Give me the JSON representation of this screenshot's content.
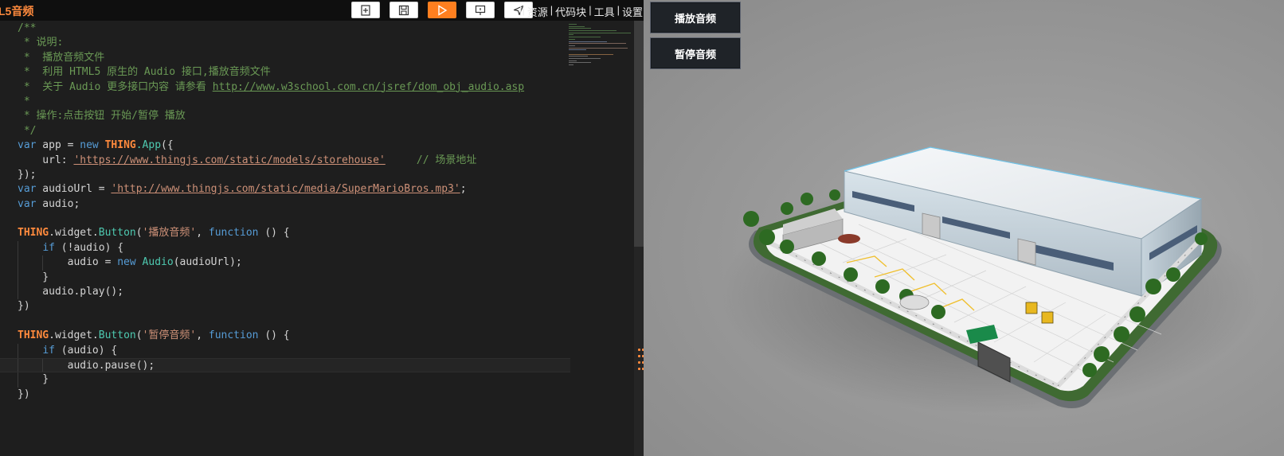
{
  "editor": {
    "file_title": "L5音频",
    "toolbar": [
      {
        "icon": "new-file-icon"
      },
      {
        "icon": "save-icon"
      },
      {
        "icon": "run-icon"
      },
      {
        "icon": "presentation-icon"
      },
      {
        "icon": "share-icon"
      }
    ],
    "menu": {
      "prefix": "||",
      "resources": "资源",
      "code_blocks": "代码块",
      "tools": "工具",
      "settings": "设置",
      "sep": "|"
    },
    "code": {
      "l1": "/**",
      "l2": " * 说明:",
      "l3": " *  播放音频文件",
      "l4": " *  利用 HTML5 原生的 Audio 接口,播放音频文件",
      "l5a": " *  关于 Audio 更多接口内容 请参看 ",
      "l5url": "http://www.w3school.com.cn/jsref/dom_obj_audio.asp",
      "l6": " *",
      "l7": " * 操作:点击按钮 开始/暂停 播放",
      "l8": " */",
      "kw_var": "var",
      "kw_new": "new",
      "kw_function": "function",
      "kw_if": "if",
      "thing": "THING",
      "app_decl": " app = ",
      "app_cls": ".App",
      "app_open": "({",
      "url_key": "    url: ",
      "scene_url": "'https://www.thingjs.com/static/models/storehouse'",
      "scene_comment": "     // 场景地址",
      "close_obj": "});",
      "audio_url_decl": " audioUrl = ",
      "audio_url_value": "'http://www.thingjs.com/static/media/SuperMarioBros.mp3'",
      "semicolon": ";",
      "audio_decl": " audio;",
      "widget": ".widget.",
      "button_cls": "Button",
      "open_paren": "(",
      "play_label": "'播放音频'",
      "pause_label": "'暂停音频'",
      "fn_tail": " () {",
      "if_not_audio": " (!audio) {",
      "if_audio": " (audio) {",
      "assign_audio": "        audio = ",
      "audio_cls": "Audio",
      "audio_args": "(audioUrl);",
      "close_brace": "    }",
      "play_call": "    audio.play();",
      "pause_call": "        audio.pause();",
      "close_call": "})"
    }
  },
  "view": {
    "play_button": "播放音频",
    "pause_button": "暂停音频"
  },
  "colors": {
    "accent": "#ff7f1f",
    "comment": "#6a9955",
    "keyword": "#569cd6",
    "string": "#ce9178",
    "class": "#4ec9b0"
  }
}
